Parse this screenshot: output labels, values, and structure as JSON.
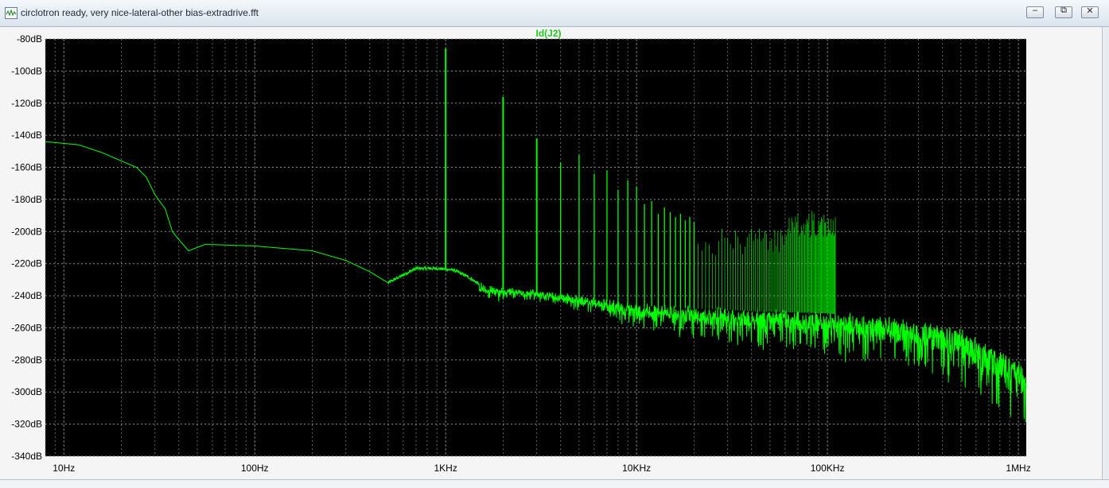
{
  "window": {
    "title": "circlotron ready, very nice-lateral-other bias-extradrive.fft",
    "icon": "waveform-icon",
    "min_glyph": "–",
    "max_glyph": "⧉",
    "close_glyph": "✕"
  },
  "colors": {
    "background": "#000000",
    "trace": "#00ff00",
    "grid": "#8c8c8c",
    "axis_text": "#000000"
  },
  "chart_data": {
    "type": "line",
    "title": "Id(J2)",
    "xscale": "log",
    "xlim": [
      8,
      1100000
    ],
    "ylim": [
      -340,
      -80
    ],
    "xticks": [
      {
        "value": 10,
        "label": "10Hz"
      },
      {
        "value": 100,
        "label": "100Hz"
      },
      {
        "value": 1000,
        "label": "1KHz"
      },
      {
        "value": 10000,
        "label": "10KHz"
      },
      {
        "value": 100000,
        "label": "100KHz"
      },
      {
        "value": 1000000,
        "label": "1MHz"
      }
    ],
    "yticks": [
      {
        "value": -80,
        "label": "-80dB"
      },
      {
        "value": -100,
        "label": "-100dB"
      },
      {
        "value": -120,
        "label": "-120dB"
      },
      {
        "value": -140,
        "label": "-140dB"
      },
      {
        "value": -160,
        "label": "-160dB"
      },
      {
        "value": -180,
        "label": "-180dB"
      },
      {
        "value": -200,
        "label": "-200dB"
      },
      {
        "value": -220,
        "label": "-220dB"
      },
      {
        "value": -240,
        "label": "-240dB"
      },
      {
        "value": -260,
        "label": "-260dB"
      },
      {
        "value": -280,
        "label": "-280dB"
      },
      {
        "value": -300,
        "label": "-300dB"
      },
      {
        "value": -320,
        "label": "-320dB"
      },
      {
        "value": -340,
        "label": "-340dB"
      }
    ],
    "grid": true,
    "series": [
      {
        "name": "Id(J2)",
        "baseline": [
          [
            8,
            -144
          ],
          [
            12,
            -146
          ],
          [
            16,
            -151
          ],
          [
            20,
            -156
          ],
          [
            24,
            -160
          ],
          [
            27,
            -166
          ],
          [
            30,
            -177
          ],
          [
            34,
            -186
          ],
          [
            37,
            -200
          ],
          [
            40,
            -205
          ],
          [
            45,
            -212
          ],
          [
            55,
            -208
          ],
          [
            100,
            -209
          ],
          [
            200,
            -212
          ],
          [
            300,
            -218
          ],
          [
            400,
            -225
          ],
          [
            500,
            -232
          ],
          [
            600,
            -227
          ],
          [
            700,
            -223
          ],
          [
            900,
            -223
          ],
          [
            1100,
            -224
          ],
          [
            1300,
            -228
          ],
          [
            1600,
            -235
          ],
          [
            2000,
            -236
          ],
          [
            3000,
            -238
          ],
          [
            5000,
            -241
          ],
          [
            10000,
            -246
          ],
          [
            20000,
            -248
          ],
          [
            50000,
            -250
          ],
          [
            100000,
            -251
          ],
          [
            200000,
            -254
          ],
          [
            500000,
            -262
          ],
          [
            1000000,
            -282
          ]
        ],
        "noise_floor": [
          [
            3000,
            -242
          ],
          [
            10000,
            -260
          ],
          [
            30000,
            -270
          ],
          [
            100000,
            -278
          ],
          [
            300000,
            -286
          ],
          [
            1000000,
            -318
          ]
        ],
        "peaks": [
          [
            1000,
            -86
          ],
          [
            2000,
            -116
          ],
          [
            3000,
            -142
          ],
          [
            4000,
            -157
          ],
          [
            5000,
            -152
          ],
          [
            6000,
            -164
          ],
          [
            7000,
            -162
          ],
          [
            8000,
            -174
          ],
          [
            9000,
            -168
          ],
          [
            10000,
            -172
          ],
          [
            11000,
            -183
          ],
          [
            12000,
            -181
          ],
          [
            13000,
            -189
          ],
          [
            14000,
            -185
          ],
          [
            15000,
            -188
          ],
          [
            16000,
            -191
          ],
          [
            17000,
            -189
          ],
          [
            18000,
            -193
          ],
          [
            19000,
            -191
          ],
          [
            20000,
            -194
          ]
        ],
        "dense_peak_range": [
          20000,
          110000
        ],
        "dense_peak_level": -198
      }
    ]
  }
}
